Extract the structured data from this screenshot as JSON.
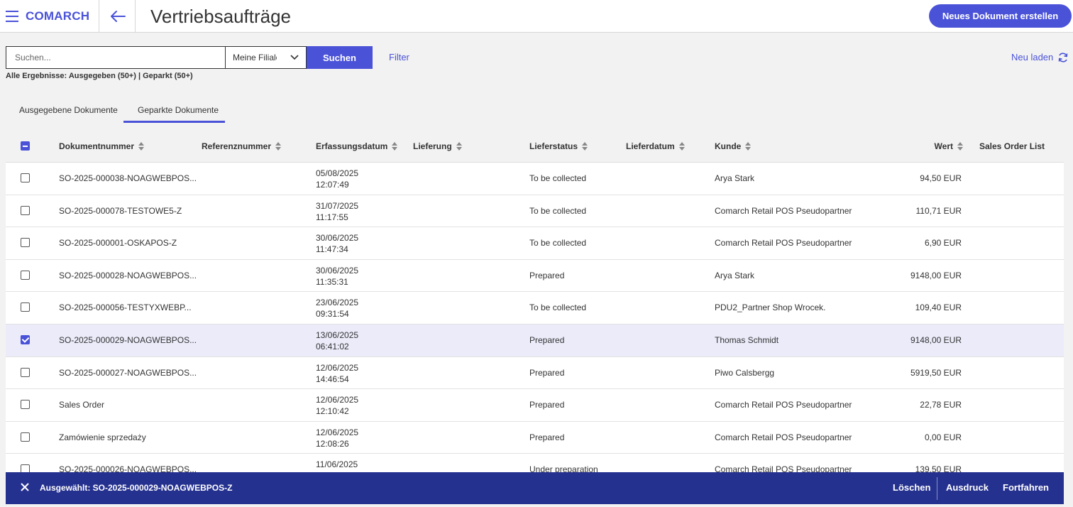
{
  "header": {
    "logo": "COMARCH",
    "title": "Vertriebsaufträge",
    "new_document_label": "Neues Dokument erstellen"
  },
  "search": {
    "placeholder": "Suchen...",
    "value": "",
    "branch_selected": "Meine Filiale",
    "search_button": "Suchen",
    "filter_label": "Filter",
    "reload_label": "Neu laden",
    "results_summary": "Alle Ergebnisse: Ausgegeben (50+) | Geparkt (50+)"
  },
  "tabs": [
    {
      "label": "Ausgegebene Dokumente",
      "active": false
    },
    {
      "label": "Geparkte Dokumente",
      "active": true
    }
  ],
  "columns": [
    "Dokumentnummer",
    "Referenznummer",
    "Erfassungsdatum",
    "Lieferung",
    "Lieferstatus",
    "Lieferdatum",
    "Kunde",
    "Wert",
    "Sales Order List"
  ],
  "rows": [
    {
      "doc": "SO-2025-000038-NOAGWEBPOS...",
      "date": "05/08/2025",
      "time": "12:07:49",
      "status": "To be collected",
      "customer": "Arya Stark",
      "value": "94,50 EUR",
      "checked": false
    },
    {
      "doc": "SO-2025-000078-TESTOWE5-Z",
      "date": "31/07/2025",
      "time": "11:17:55",
      "status": "To be collected",
      "customer": "Comarch Retail POS Pseudopartner",
      "value": "110,71 EUR",
      "checked": false
    },
    {
      "doc": "SO-2025-000001-OSKAPOS-Z",
      "date": "30/06/2025",
      "time": "11:47:34",
      "status": "To be collected",
      "customer": "Comarch Retail POS Pseudopartner",
      "value": "6,90 EUR",
      "checked": false
    },
    {
      "doc": "SO-2025-000028-NOAGWEBPOS...",
      "date": "30/06/2025",
      "time": "11:35:31",
      "status": "Prepared",
      "customer": "Arya Stark",
      "value": "9148,00 EUR",
      "checked": false
    },
    {
      "doc": "SO-2025-000056-TESTYXWEBP...",
      "date": "23/06/2025",
      "time": "09:31:54",
      "status": "To be collected",
      "customer": "PDU2_Partner Shop Wrocek.",
      "value": "109,40 EUR",
      "checked": false
    },
    {
      "doc": "SO-2025-000029-NOAGWEBPOS...",
      "date": "13/06/2025",
      "time": "06:41:02",
      "status": "Prepared",
      "customer": "Thomas Schmidt",
      "value": "9148,00 EUR",
      "checked": true
    },
    {
      "doc": "SO-2025-000027-NOAGWEBPOS...",
      "date": "12/06/2025",
      "time": "14:46:54",
      "status": "Prepared",
      "customer": "Piwo Calsbergg",
      "value": "5919,50 EUR",
      "checked": false
    },
    {
      "doc": "Sales Order",
      "date": "12/06/2025",
      "time": "12:10:42",
      "status": "Prepared",
      "customer": "Comarch Retail POS Pseudopartner",
      "value": "22,78 EUR",
      "checked": false
    },
    {
      "doc": "Zamówienie sprzedaży",
      "date": "12/06/2025",
      "time": "12:08:26",
      "status": "Prepared",
      "customer": "Comarch Retail POS Pseudopartner",
      "value": "0,00 EUR",
      "checked": false
    },
    {
      "doc": "SO-2025-000026-NOAGWEBPOS...",
      "date": "11/06/2025",
      "time": "",
      "status": "Under preparation",
      "customer": "Comarch Retail POS Pseudopartner",
      "value": "139,50 EUR",
      "checked": false
    }
  ],
  "bottom_bar": {
    "selected_text": "Ausgewählt: SO-2025-000029-NOAGWEBPOS-Z",
    "delete_label": "Löschen",
    "print_label": "Ausdruck",
    "continue_label": "Fortfahren"
  },
  "colors": {
    "accent": "#4a52d8",
    "bottom_bar": "#25318f",
    "selected_row": "#ebebfa"
  }
}
